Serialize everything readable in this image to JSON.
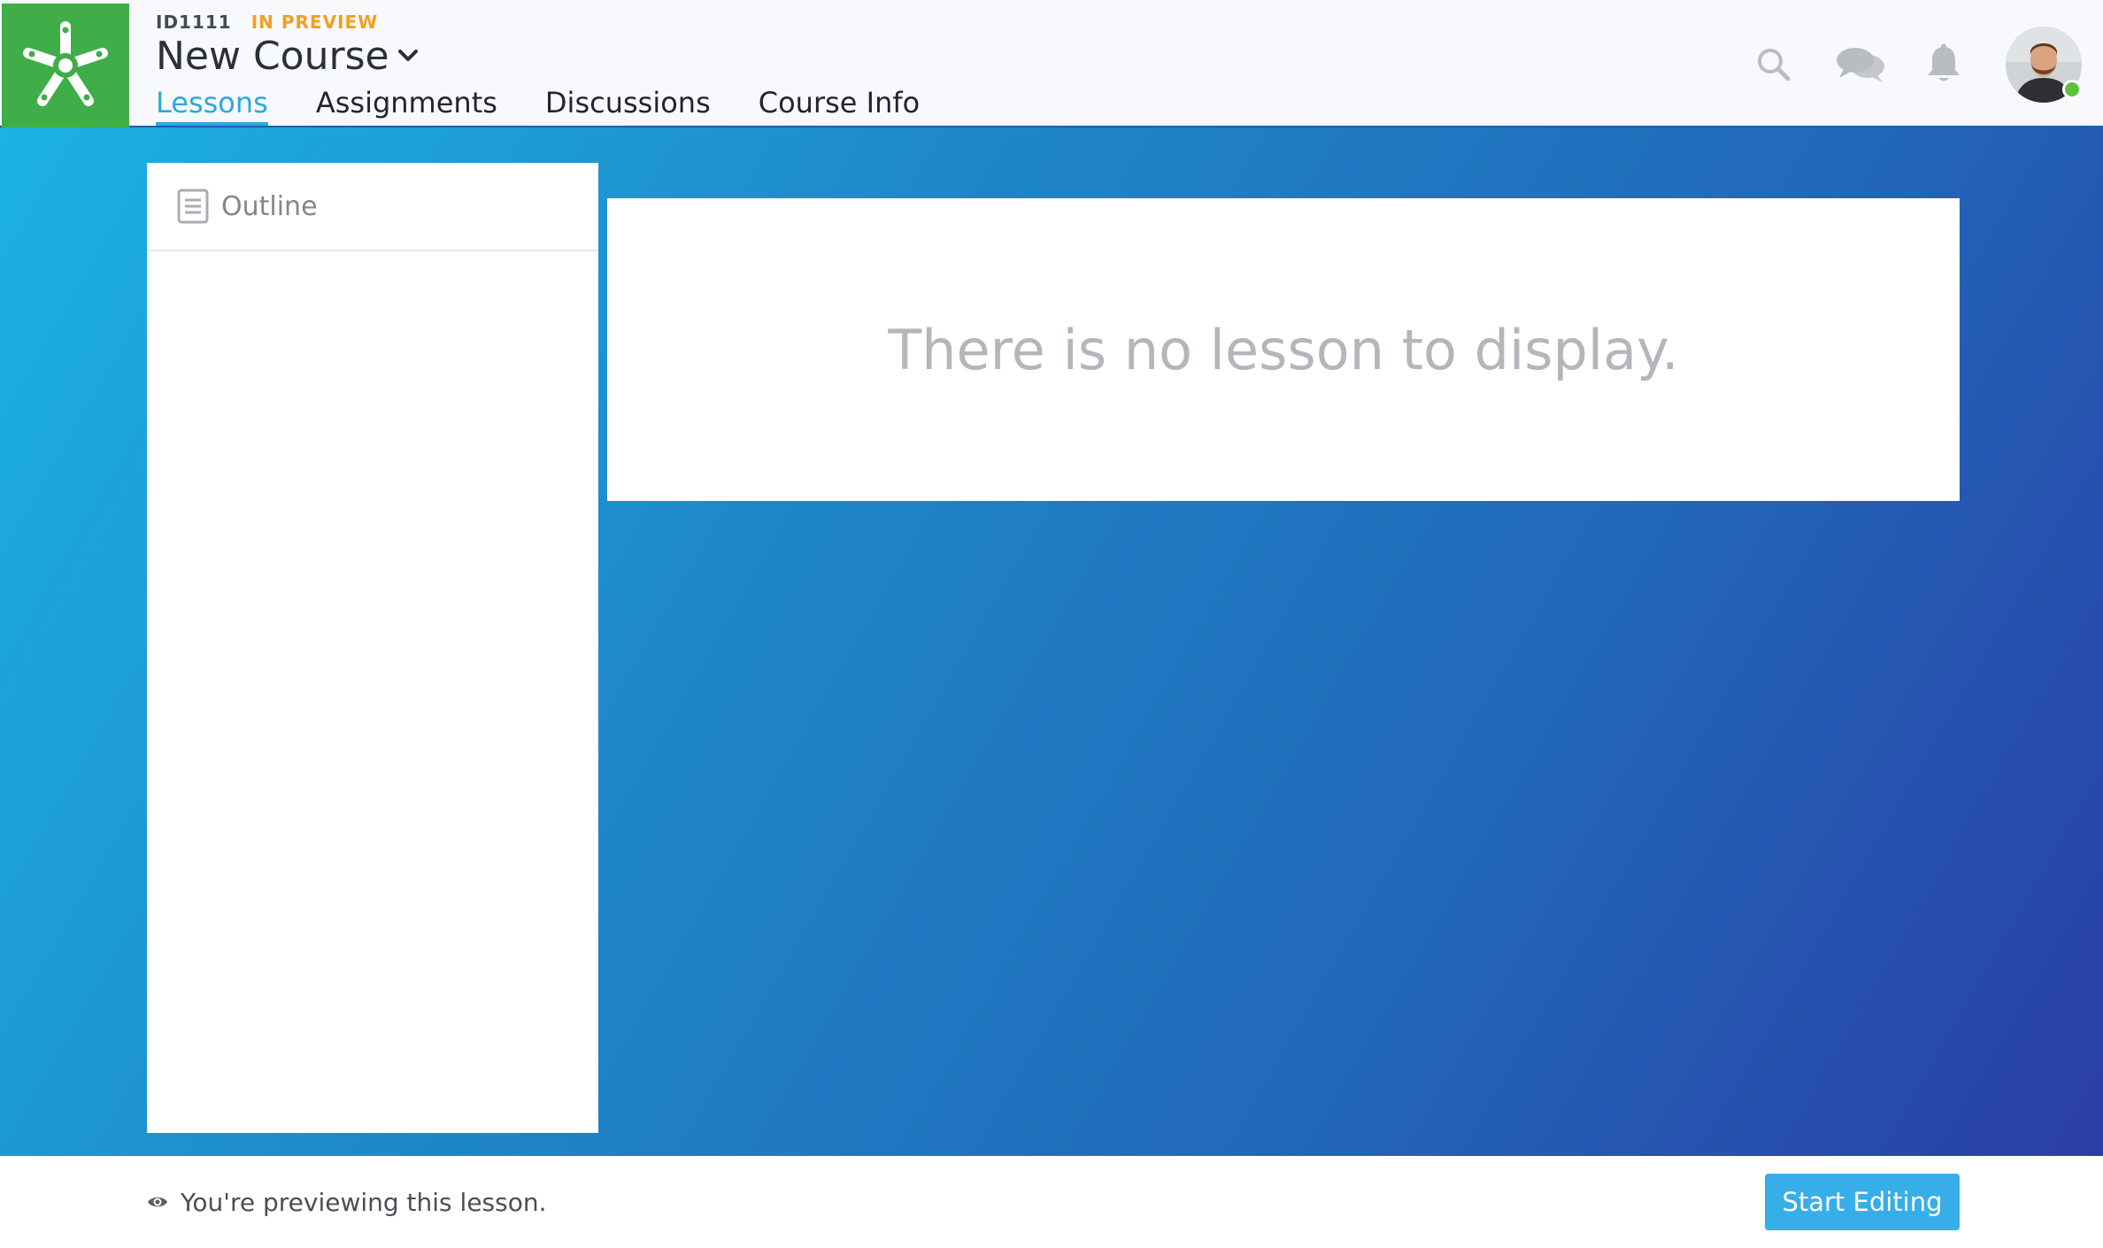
{
  "header": {
    "course_id": "ID1111",
    "status": "IN PREVIEW",
    "course_title": "New Course",
    "tabs": [
      {
        "label": "Lessons",
        "active": true
      },
      {
        "label": "Assignments",
        "active": false
      },
      {
        "label": "Discussions",
        "active": false
      },
      {
        "label": "Course Info",
        "active": false
      }
    ],
    "icons": [
      "search-icon",
      "chat-icon",
      "bell-icon"
    ],
    "user_presence": "online"
  },
  "outline": {
    "label": "Outline",
    "items": []
  },
  "main": {
    "empty_message": "There is no lesson to display."
  },
  "footer": {
    "preview_message": "You're previewing this lesson.",
    "start_editing_label": "Start Editing"
  },
  "colors": {
    "logo_green": "#3fae48",
    "accent_blue": "#2aa9df",
    "status_orange": "#f0a020",
    "button_blue": "#38aee8",
    "gradient_start": "#1cb2e2",
    "gradient_end": "#2a3ea6"
  }
}
